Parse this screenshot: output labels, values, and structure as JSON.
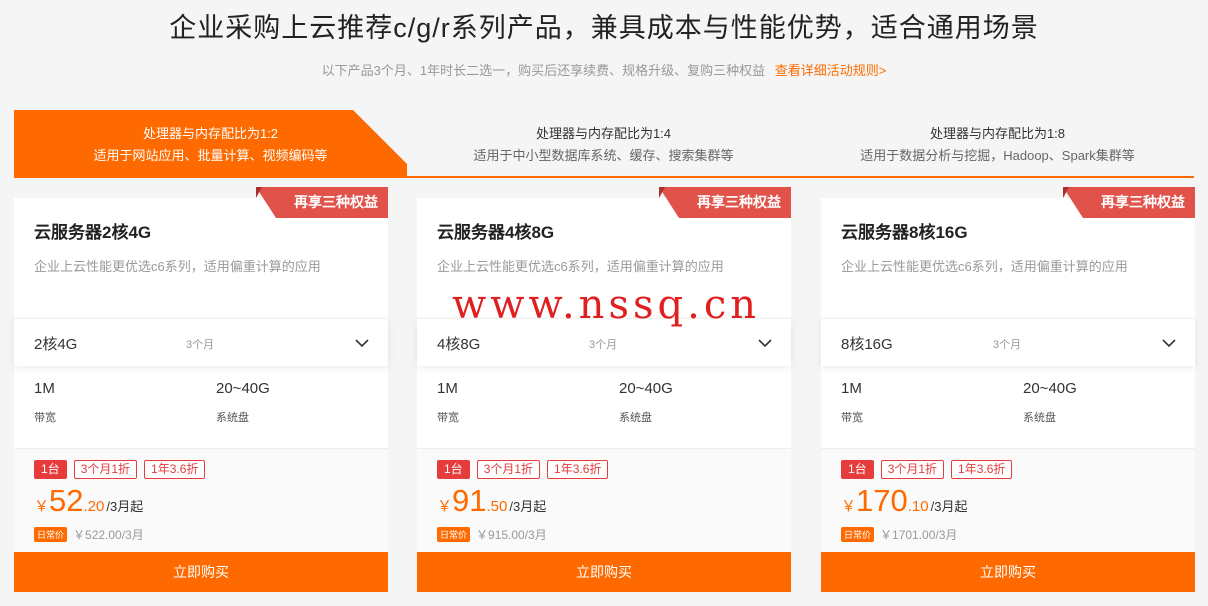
{
  "header": {
    "title": "企业采购上云推荐c/g/r系列产品，兼具成本与性能优势，适合通用场景",
    "subtitle": "以下产品3个月、1年时长二选一，购买后还享续费、规格升级、复购三种权益",
    "rules_link": "查看详细活动规则>"
  },
  "tabs": [
    {
      "line1": "处理器与内存配比为1:2",
      "line2": "适用于网站应用、批量计算、视频编码等",
      "active": true
    },
    {
      "line1": "处理器与内存配比为1:4",
      "line2": "适用于中小型数据库系统、缓存、搜索集群等",
      "active": false
    },
    {
      "line1": "处理器与内存配比为1:8",
      "line2": "适用于数据分析与挖掘，Hadoop、Spark集群等",
      "active": false
    }
  ],
  "cards": [
    {
      "badge": "再享三种权益",
      "name": "云服务器2核4G",
      "desc": "企业上云性能更优选c6系列，适用偏重计算的应用",
      "spec_value": "2核4G",
      "duration": "3个月",
      "bandwidth_value": "1M",
      "bandwidth_label": "带宽",
      "disk_value": "20~40G",
      "disk_label": "系统盘",
      "tags": [
        "1台",
        "3个月1折",
        "1年3.6折"
      ],
      "price_currency": "￥",
      "price_int": "52",
      "price_dec": ".20",
      "price_unit": "/3月起",
      "daily_label": "日常价",
      "orig_price": "￥522.00/3月",
      "buy_label": "立即购买"
    },
    {
      "badge": "再享三种权益",
      "name": "云服务器4核8G",
      "desc": "企业上云性能更优选c6系列，适用偏重计算的应用",
      "spec_value": "4核8G",
      "duration": "3个月",
      "bandwidth_value": "1M",
      "bandwidth_label": "带宽",
      "disk_value": "20~40G",
      "disk_label": "系统盘",
      "tags": [
        "1台",
        "3个月1折",
        "1年3.6折"
      ],
      "price_currency": "￥",
      "price_int": "91",
      "price_dec": ".50",
      "price_unit": "/3月起",
      "daily_label": "日常价",
      "orig_price": "￥915.00/3月",
      "buy_label": "立即购买"
    },
    {
      "badge": "再享三种权益",
      "name": "云服务器8核16G",
      "desc": "企业上云性能更优选c6系列，适用偏重计算的应用",
      "spec_value": "8核16G",
      "duration": "3个月",
      "bandwidth_value": "1M",
      "bandwidth_label": "带宽",
      "disk_value": "20~40G",
      "disk_label": "系统盘",
      "tags": [
        "1台",
        "3个月1折",
        "1年3.6折"
      ],
      "price_currency": "￥",
      "price_int": "170",
      "price_dec": ".10",
      "price_unit": "/3月起",
      "daily_label": "日常价",
      "orig_price": "￥1701.00/3月",
      "buy_label": "立即购买"
    }
  ],
  "watermark": "www.nssq.cn",
  "colors": {
    "accent": "#ff6a00",
    "badge_red": "#e0524a",
    "tag_red": "#e63c3c"
  }
}
